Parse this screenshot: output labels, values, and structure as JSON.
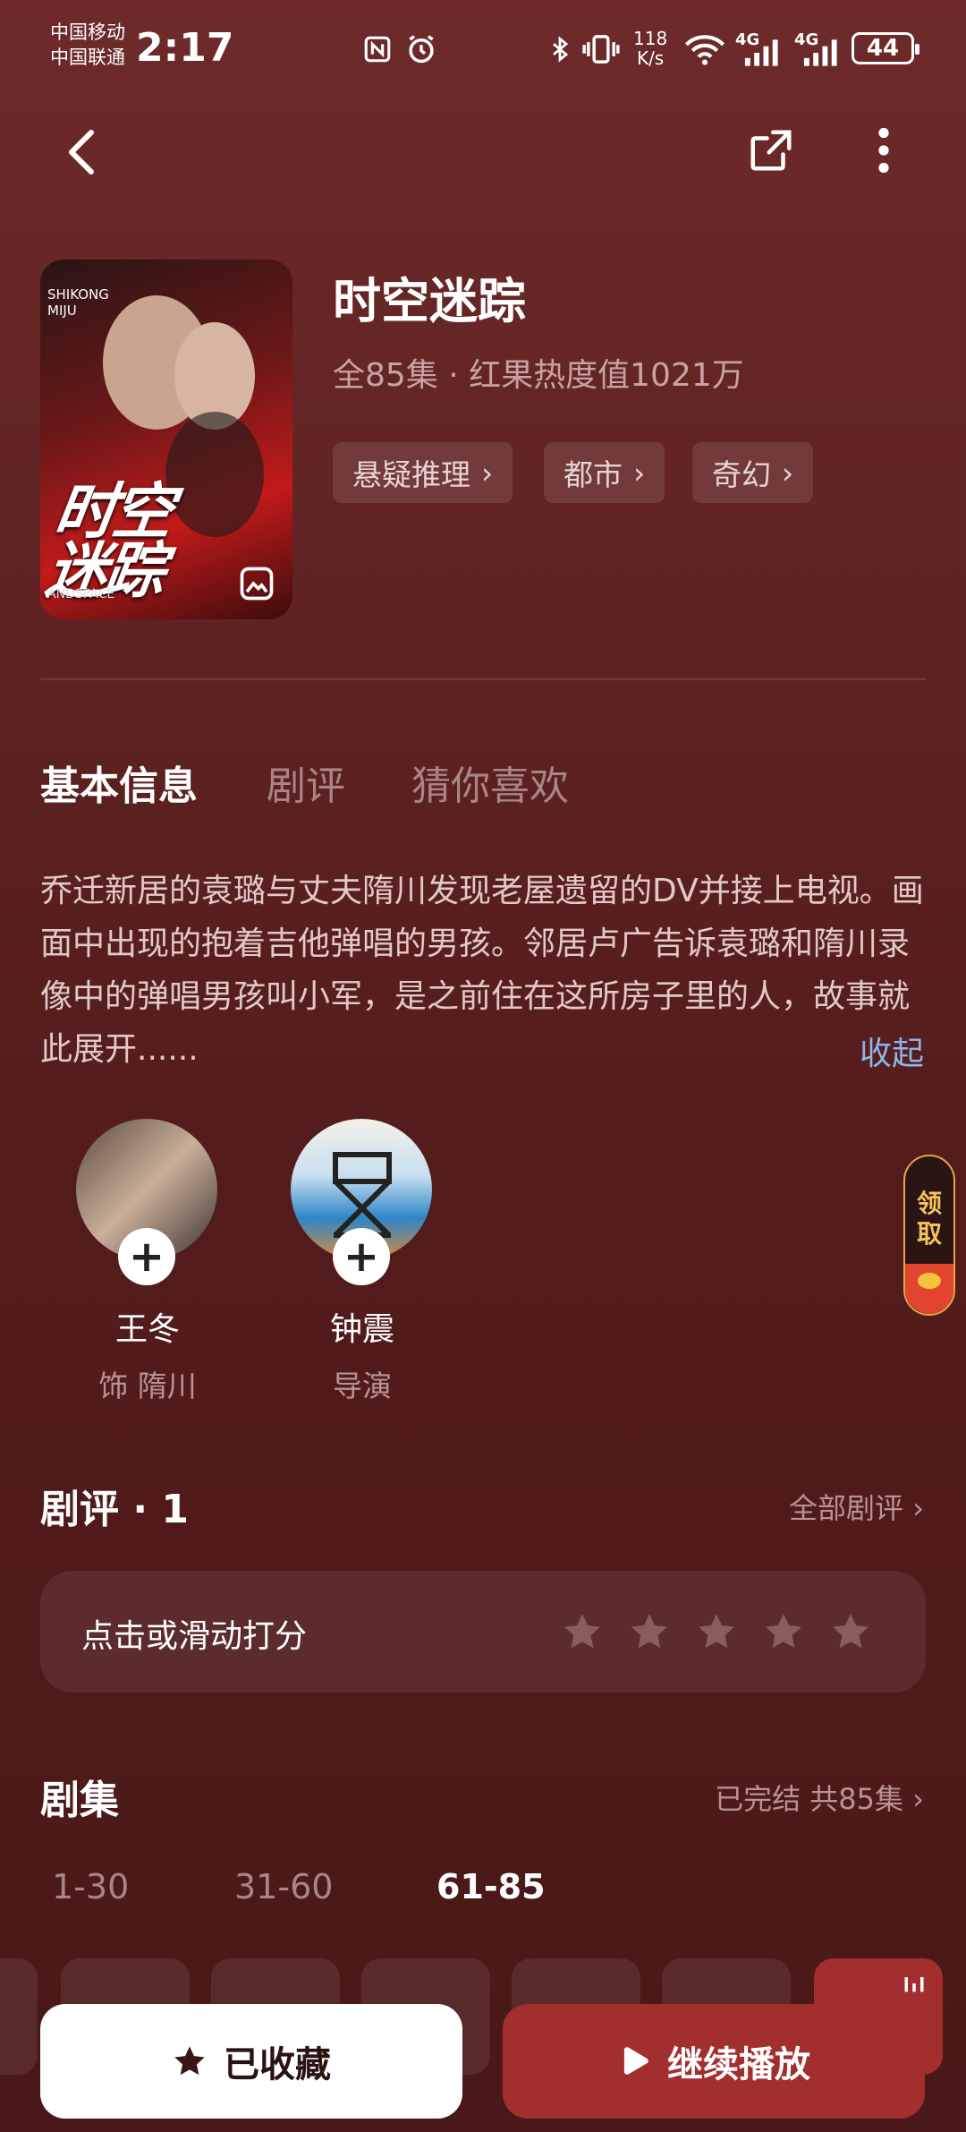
{
  "status_bar": {
    "carrier1": "中国移动",
    "carrier2": "中国联通",
    "time": "2:17",
    "speed_top": "118",
    "speed_bottom": "K/s",
    "net1": "4G",
    "net2": "4G",
    "battery": "44"
  },
  "show": {
    "title": "时空迷踪",
    "meta": "全85集 · 红果热度值1021万",
    "tags": [
      "悬疑推理",
      "都市",
      "奇幻"
    ],
    "poster_title": "时空迷踪",
    "poster_small1": "SHIKONG",
    "poster_small2": "MIJU",
    "poster_bottom": "ANDSPACE"
  },
  "tabs": [
    "基本信息",
    "剧评",
    "猜你喜欢"
  ],
  "description": "乔迁新居的袁璐与丈夫隋川发现老屋遗留的DV并接上电视。画面中出现的抱着吉他弹唱的男孩。邻居卢广告诉袁璐和隋川录像中的弹唱男孩叫小军，是之前住在这所房子里的人，故事就此展开......",
  "collapse_label": "收起",
  "cast": [
    {
      "name": "王冬",
      "role": "饰 隋川"
    },
    {
      "name": "钟震",
      "role": "导演"
    }
  ],
  "reviews": {
    "heading": "剧评 · 1",
    "all_label": "全部剧评",
    "rate_prompt": "点击或滑动打分"
  },
  "episodes": {
    "heading": "剧集",
    "status": "已完结 共85集",
    "ranges": [
      "1-30",
      "31-60",
      "61-85"
    ],
    "selected_range": "61-85"
  },
  "claim": {
    "line1": "领",
    "line2": "取"
  },
  "bottom": {
    "fav_label": "已收藏",
    "play_label": "继续播放"
  },
  "colors": {
    "accent_blue": "#8fb4ea",
    "play_button": "#a32e2e",
    "background": "#5f2222"
  }
}
